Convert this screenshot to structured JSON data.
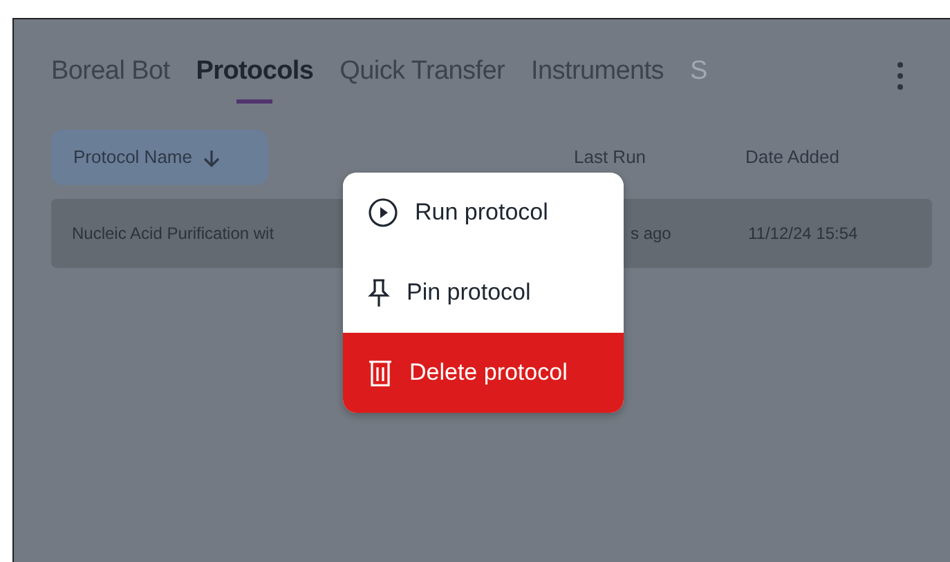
{
  "tabs": [
    {
      "label": "Boreal Bot",
      "selected": false
    },
    {
      "label": "Protocols",
      "selected": true
    },
    {
      "label": "Quick Transfer",
      "selected": false
    },
    {
      "label": "Instruments",
      "selected": false
    },
    {
      "label": "S",
      "selected": false
    }
  ],
  "table": {
    "columns": [
      {
        "label": "Protocol Name",
        "sorted": true
      },
      {
        "label": "Last Run",
        "sorted": false
      },
      {
        "label": "Date Added",
        "sorted": false
      }
    ],
    "rows": [
      [
        "Nucleic Acid Purification wit",
        "s ago",
        "11/12/24 15:54"
      ]
    ]
  },
  "menu": {
    "items": [
      {
        "label": "Run protocol",
        "kind": "run"
      },
      {
        "label": "Pin protocol",
        "kind": "pin"
      },
      {
        "label": "Delete protocol",
        "kind": "delete"
      }
    ]
  }
}
